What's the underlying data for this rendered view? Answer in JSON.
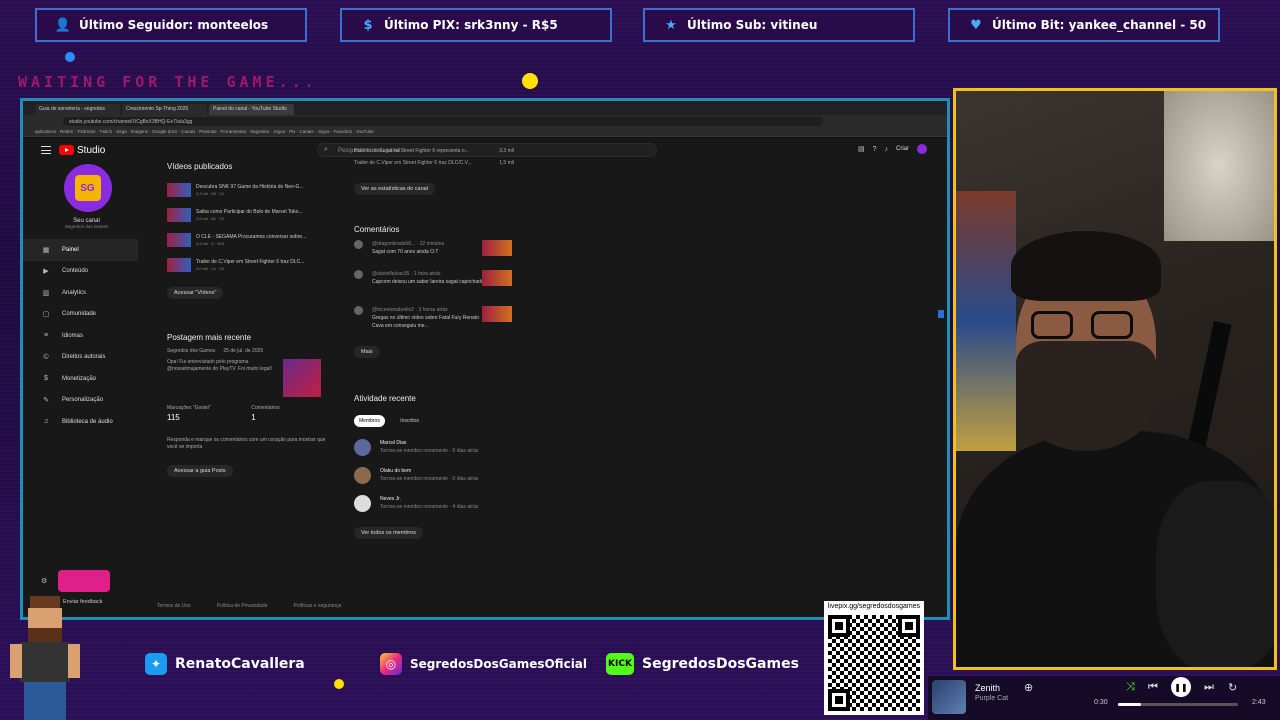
{
  "overlay": {
    "alerts": [
      {
        "icon": "user-icon",
        "label": "Último Seguidor: monteelos"
      },
      {
        "icon": "dollar-icon",
        "label": "Último PIX: srk3nny - R$5"
      },
      {
        "icon": "star-icon",
        "label": "Último Sub: vitineu"
      },
      {
        "icon": "heart-icon",
        "label": "Último Bit: yankee_channel - 50"
      }
    ],
    "waiting_text": "WAITING FOR THE GAME...",
    "socials": [
      {
        "icon": "twitter-icon",
        "label": "RenatoCavallera"
      },
      {
        "icon": "instagram-icon",
        "label": "SegredosDosGamesOficial"
      },
      {
        "icon": "kick-icon",
        "badge": "KICK",
        "label": "SegredosDosGames"
      }
    ],
    "qr_url": "livepix.gg/segredosdosgames",
    "colors": {
      "cam_border": "#f2c21b",
      "browser_border": "#1f8fb8",
      "accent": "#8a2be2"
    }
  },
  "browser": {
    "tabs": [
      "Guia de sorveteria - segredos",
      "Crescimento Sp-Thing 2025",
      "Painel do canal - YouTube Studio"
    ],
    "url": "studio.youtube.com/channel/UCgBsX3BHQ-Ex7/a/a3gg",
    "bookmarks": "aplicativos · Redes · TrStream · Twitch · Sega · Imagens · Google docs · Canais · Pessoas · Ferramentas · Segredos · Jogos · Pix · Canais · Jogos · Favoritos · YouTube"
  },
  "studio": {
    "brand": "Studio",
    "search_placeholder": "Pesquisar no seu canal",
    "create_label": "Criar",
    "channel": {
      "title": "Seu canal",
      "subtitle": "Segredos dos Games"
    },
    "nav": [
      {
        "icon": "dashboard-icon",
        "label": "Painel",
        "active": true
      },
      {
        "icon": "content-icon",
        "label": "Conteúdo"
      },
      {
        "icon": "analytics-icon",
        "label": "Analytics"
      },
      {
        "icon": "community-icon",
        "label": "Comunidade"
      },
      {
        "icon": "language-icon",
        "label": "Idiomas"
      },
      {
        "icon": "copyright-icon",
        "label": "Direitos autorais"
      },
      {
        "icon": "money-icon",
        "label": "Monetização"
      },
      {
        "icon": "customize-icon",
        "label": "Personalização"
      },
      {
        "icon": "audio-library-icon",
        "label": "Biblioteca de áudio"
      }
    ],
    "settings_label": "Enviar feedback",
    "published": {
      "heading": "Vídeos publicados",
      "videos": [
        {
          "title": "Descubra SNK 97 Game da História do Neo-G...",
          "meta": "3,3 mil · 63 · 12"
        },
        {
          "title": "Saiba como Participar do Bolo de Marvel Toko...",
          "meta": "2,5 mil · 62 · 20"
        },
        {
          "title": "O CLE - SEGAMA Procuramos conversar sobre...",
          "meta": "4,3 mil · 6 · 423"
        },
        {
          "title": "Trailer de C.Viper em Street Fighter 6 traz DLC...",
          "meta": "4,0 mil · 14 · 20"
        }
      ],
      "button": "Acessar \"Vídeos\""
    },
    "latest_post": {
      "heading": "Postagem mais recente",
      "author": "Segredos dos Games",
      "date": "25 de jul. de 2025",
      "text": "Opa! Fui entrevistado pelo programa @nosselmajamente do PlayTV. Foi muito legal!",
      "stats": [
        {
          "label": "Marcações \"Gostei\"",
          "value": "115"
        },
        {
          "label": "Comentários",
          "value": "1"
        }
      ],
      "hint": "Responda e marque os comentários com um coração para mostrar que você se importa",
      "button": "Acessar a guia Posts"
    },
    "top_videos": [
      {
        "title": "História do Sagat no Street Fighter 6 representa o...",
        "value": "3,3 mil"
      },
      {
        "title": "Trailer de C.Viper em Street Fighter 6 traz DLC/C.V...",
        "value": "1,5 mil"
      }
    ],
    "stats_button": "Ver as estatísticas do canal",
    "comments": {
      "heading": "Comentários",
      "items": [
        {
          "author": "@dragonbrade58...",
          "time": "32 minutos",
          "text": "Sagat com 70 anos ainda O.T"
        },
        {
          "author": "@danielfalcao35",
          "time": "1 hora atrás",
          "text": "Capcom deixou um sabor lareira sagat caprichado"
        },
        {
          "author": "@tricentenaberlin2",
          "time": "3 horas atrás",
          "text": "Gregas no último vídeo sobre Fatal Fury Renato Cava em conseguiu me..."
        }
      ],
      "more": "Mais"
    },
    "activity": {
      "heading": "Atividade recente",
      "tabs": [
        "Membros",
        "Inscritos"
      ],
      "members": [
        {
          "name": "Marcel Dias",
          "desc": "Tornou-se membro novamente · 0 dias atrás"
        },
        {
          "name": "Olaku do bem",
          "desc": "Tornou-se membro novamente · 0 dias atrás"
        },
        {
          "name": "Neves Jr.",
          "desc": "Tornou-se membro novamente · 4 dias atrás"
        }
      ],
      "all_button": "Ver todos os membros"
    },
    "footer": [
      "Termos de Uso",
      "Política de Privacidade",
      "Políticas e segurança"
    ]
  },
  "player": {
    "title": "Zenith",
    "artist": "Purple Cat",
    "elapsed": "0:30",
    "total": "2:43",
    "progress": 0.19
  }
}
